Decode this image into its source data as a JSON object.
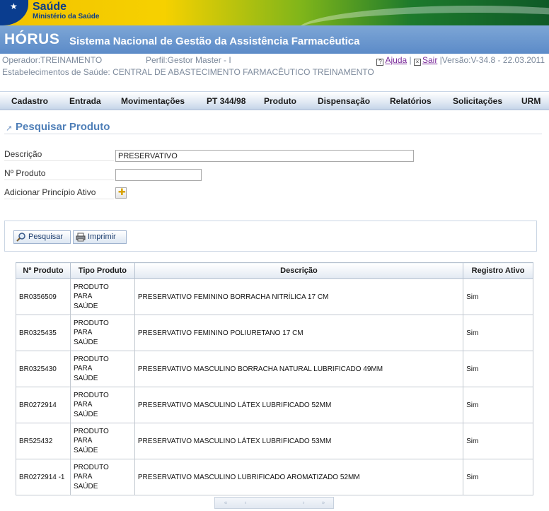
{
  "banner": {
    "brand_top": "Saúde",
    "brand_bottom": "Ministério da Saúde"
  },
  "app": {
    "name": "HÓRUS",
    "subtitle": "Sistema Nacional de Gestão da Assistência Farmacêutica"
  },
  "info": {
    "operator": "Operador:TREINAMENTO",
    "profile": "Perfil:Gestor Master - I",
    "help": "Ajuda",
    "exit": "Sair",
    "version": "|Versão:V-34.8 - 22.03.2011",
    "establishment": "Estabelecimentos de Saúde: CENTRAL DE ABASTECIMENTO FARMACÊUTICO TREINAMENTO"
  },
  "menu": [
    "Cadastro",
    "Entrada",
    "Movimentações",
    "PT 344/98",
    "Produto",
    "Dispensação",
    "Relatórios",
    "Solicitações",
    "URM"
  ],
  "page": {
    "title": "Pesquisar Produto"
  },
  "form": {
    "descricao_label": "Descrição",
    "descricao_value": "PRESERVATIVO",
    "numero_label": "Nº Produto",
    "numero_value": "",
    "principio_label": "Adicionar Princípio Ativo"
  },
  "buttons": {
    "pesquisar": "Pesquisar",
    "imprimir": "Imprimir"
  },
  "table": {
    "headers": [
      "Nº Produto",
      "Tipo Produto",
      "Descrição",
      "Registro Ativo"
    ],
    "rows": [
      {
        "numero": "BR0356509",
        "tipo": [
          "PRODUTO",
          "PARA",
          "SAÚDE"
        ],
        "descricao": "PRESERVATIVO FEMININO BORRACHA NITRÍLICA 17 CM",
        "ativo": "Sim"
      },
      {
        "numero": "BR0325435",
        "tipo": [
          "PRODUTO",
          "PARA",
          "SAÚDE"
        ],
        "descricao": "PRESERVATIVO FEMININO POLIURETANO 17 CM",
        "ativo": "Sim"
      },
      {
        "numero": "BR0325430",
        "tipo": [
          "PRODUTO",
          "PARA",
          "SAÚDE"
        ],
        "descricao": "PRESERVATIVO MASCULINO BORRACHA NATURAL LUBRIFICADO 49MM",
        "ativo": "Sim"
      },
      {
        "numero": "BR0272914",
        "tipo": [
          "PRODUTO",
          "PARA",
          "SAÚDE"
        ],
        "descricao": "PRESERVATIVO MASCULINO LÁTEX LUBRIFICADO 52MM",
        "ativo": "Sim"
      },
      {
        "numero": "BR525432",
        "tipo": [
          "PRODUTO",
          "PARA",
          "SAÚDE"
        ],
        "descricao": "PRESERVATIVO MASCULINO LÁTEX LUBRIFICADO 53MM",
        "ativo": "Sim"
      },
      {
        "numero": "BR0272914 -1",
        "tipo": [
          "PRODUTO",
          "PARA",
          "SAÚDE"
        ],
        "descricao": "PRESERVATIVO MASCULINO LUBRIFICADO AROMATIZADO 52MM",
        "ativo": "Sim"
      }
    ]
  },
  "pager": {
    "first": "«",
    "prev": "‹",
    "next": "›",
    "last": "»"
  },
  "colors": {
    "title_bar": "#5c8bc8",
    "heading": "#4f7fb8",
    "link": "#7a2a9a"
  },
  "icons": {
    "search": "magnifier-icon",
    "print": "printer-icon",
    "add": "plus-icon",
    "help": "help-icon",
    "exit": "close-icon"
  }
}
